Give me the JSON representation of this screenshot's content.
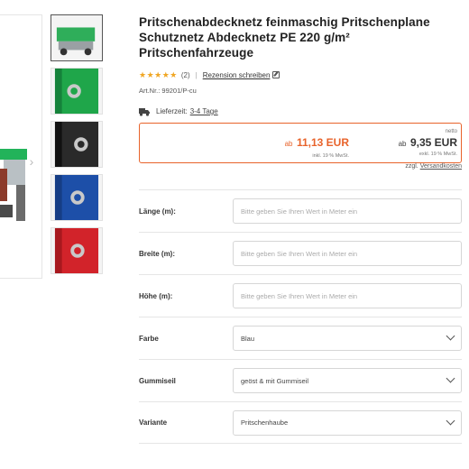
{
  "product": {
    "title": "Pritschenabdecknetz feinmaschig Pritschenplane Schutznetz Abdecknetz PE 220 g/m² Pritschenfahrzeuge",
    "rating": {
      "stars": "★★★★★",
      "count": "(2)",
      "review_link": "Rezension schreiben"
    },
    "art_nr": "Art.Nr.: 99201/P-cu",
    "delivery": {
      "label": "Lieferzeit:",
      "time": "3-4 Tage"
    }
  },
  "price": {
    "gross": {
      "prefix": "ab",
      "amount": "11,13 EUR",
      "vat": "inkl. 19 % MwSt."
    },
    "net": {
      "label": "netto",
      "prefix": "ab",
      "amount": "9,35 EUR",
      "vat": "exkl. 19 % MwSt."
    },
    "shipping_prefix": "zzgl.",
    "shipping_link": "Versandkosten",
    "accent_color": "#e8632b"
  },
  "options": [
    {
      "label": "Länge (m):",
      "type": "input",
      "placeholder": "Bitte geben Sie Ihren Wert in Meter ein"
    },
    {
      "label": "Breite (m):",
      "type": "input",
      "placeholder": "Bitte geben Sie Ihren Wert in Meter ein"
    },
    {
      "label": "Höhe (m):",
      "type": "input",
      "placeholder": "Bitte geben Sie Ihren Wert in Meter ein"
    },
    {
      "label": "Farbe",
      "type": "select",
      "value": "Blau"
    },
    {
      "label": "Gummiseil",
      "type": "select",
      "value": "geöst & mit Gummiseil"
    },
    {
      "label": "Variante",
      "type": "select",
      "value": "Pritschenhaube"
    }
  ],
  "thumbnails": [
    {
      "name": "truck-net-thumbnail",
      "color": "#2fae5a"
    },
    {
      "name": "green-net-thumbnail",
      "color": "#1fa64a"
    },
    {
      "name": "black-net-thumbnail",
      "color": "#2a2a2a"
    },
    {
      "name": "blue-net-thumbnail",
      "color": "#1d4fa8"
    },
    {
      "name": "red-net-thumbnail",
      "color": "#d2232a"
    }
  ]
}
